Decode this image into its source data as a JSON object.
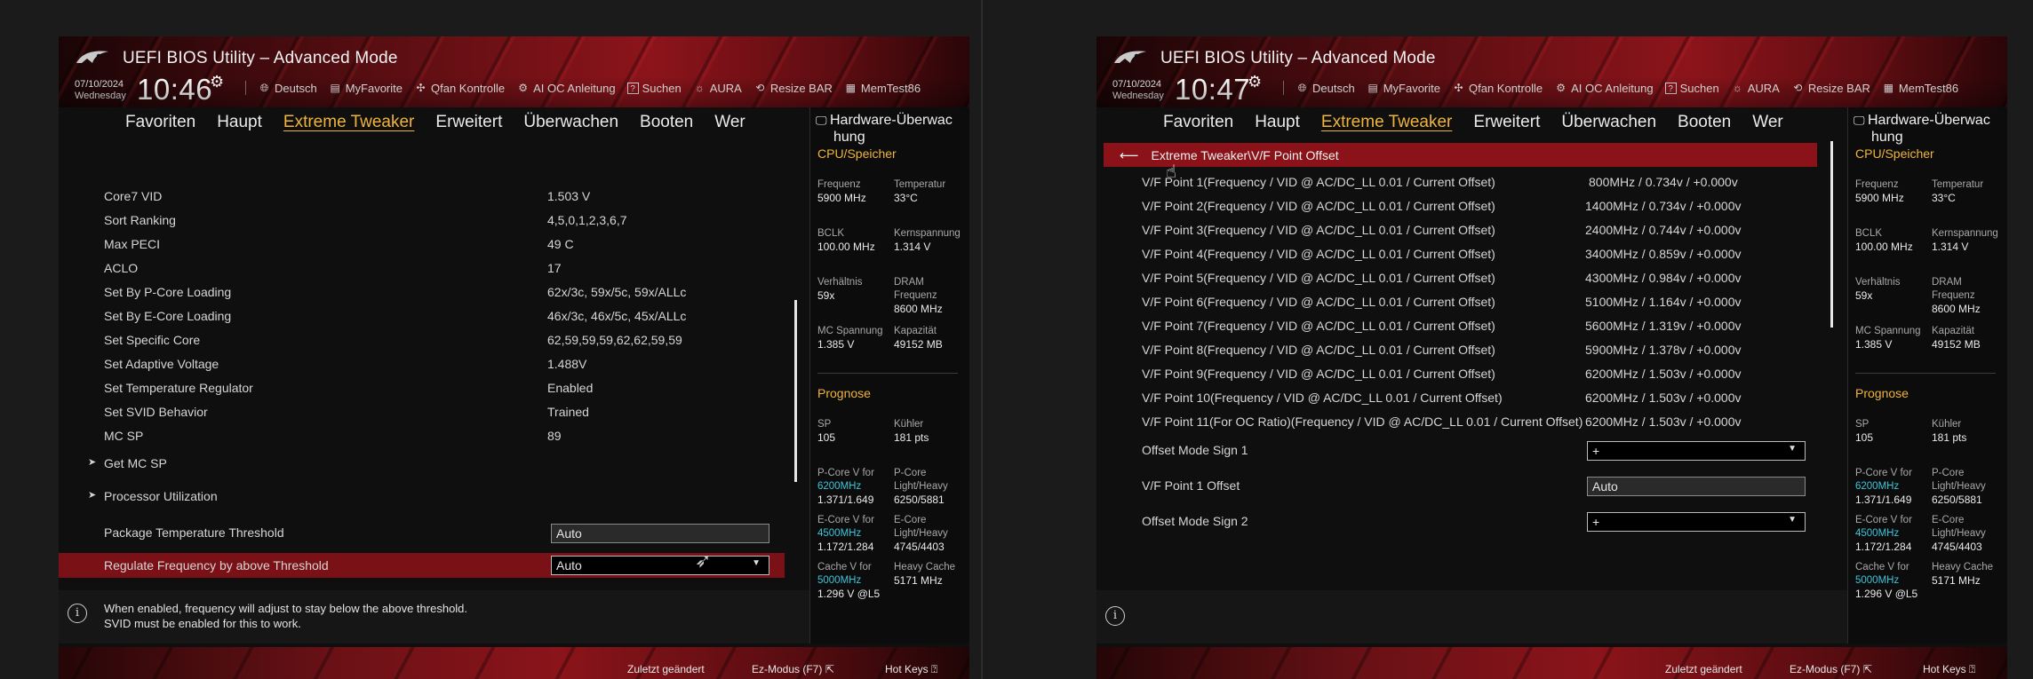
{
  "app": {
    "title": "UEFI BIOS Utility – Advanced Mode",
    "date": "07/10/2024",
    "weekday": "Wednesday"
  },
  "toolbar": {
    "language": "Deutsch",
    "myfavorite": "MyFavorite",
    "qfan": "Qfan Kontrolle",
    "aioc": "AI OC Anleitung",
    "search": "Suchen",
    "aura": "AURA",
    "resizebar": "Resize BAR",
    "memtest": "MemTest86",
    "search_key": "?"
  },
  "menu": [
    "Favoriten",
    "Haupt",
    "Extreme Tweaker",
    "Erweitert",
    "Überwachen",
    "Booten",
    "Wer"
  ],
  "left": {
    "clock": "10:46",
    "rows": [
      {
        "label": "Core7 VID",
        "value": "1.503 V"
      },
      {
        "label": "Sort Ranking",
        "value": "4,5,0,1,2,3,6,7"
      },
      {
        "label": "Max PECI",
        "value": "49 C"
      },
      {
        "label": "ACLO",
        "value": "17"
      },
      {
        "label": "Set By P-Core Loading",
        "value": "62x/3c, 59x/5c, 59x/ALLc"
      },
      {
        "label": "Set By E-Core Loading",
        "value": "46x/3c, 46x/5c, 45x/ALLc"
      },
      {
        "label": "Set Specific Core",
        "value": "62,59,59,59,62,62,59,59"
      },
      {
        "label": "Set Adaptive Voltage",
        "value": "1.488V"
      },
      {
        "label": "Set Temperature Regulator",
        "value": "Enabled"
      },
      {
        "label": "Set SVID Behavior",
        "value": "Trained"
      },
      {
        "label": "MC SP",
        "value": "89"
      }
    ],
    "submenus": [
      "Get MC SP",
      "Processor Utilization"
    ],
    "threshold_label": "Package Temperature Threshold",
    "threshold_value": "Auto",
    "regulate_label": "Regulate Frequency by above Threshold",
    "regulate_value": "Auto",
    "info_line1": "When enabled, frequency will adjust to stay below the above threshold.",
    "info_line2": "SVID must be enabled for this to work."
  },
  "right": {
    "clock": "10:47",
    "breadcrumb": "Extreme Tweaker\\V/F Point Offset",
    "points": [
      {
        "label": "V/F Point 1(Frequency / VID @ AC/DC_LL 0.01 / Current Offset)",
        "value": "800MHz / 0.734v / +0.000v"
      },
      {
        "label": "V/F Point 2(Frequency / VID @ AC/DC_LL 0.01 / Current Offset)",
        "value": "1400MHz / 0.734v / +0.000v"
      },
      {
        "label": "V/F Point 3(Frequency / VID @ AC/DC_LL 0.01 / Current Offset)",
        "value": "2400MHz / 0.744v / +0.000v"
      },
      {
        "label": "V/F Point 4(Frequency / VID @ AC/DC_LL 0.01 / Current Offset)",
        "value": "3400MHz / 0.859v / +0.000v"
      },
      {
        "label": "V/F Point 5(Frequency / VID @ AC/DC_LL 0.01 / Current Offset)",
        "value": "4300MHz / 0.984v / +0.000v"
      },
      {
        "label": "V/F Point 6(Frequency / VID @ AC/DC_LL 0.01 / Current Offset)",
        "value": "5100MHz / 1.164v / +0.000v"
      },
      {
        "label": "V/F Point 7(Frequency / VID @ AC/DC_LL 0.01 / Current Offset)",
        "value": "5600MHz / 1.319v / +0.000v"
      },
      {
        "label": "V/F Point 8(Frequency / VID @ AC/DC_LL 0.01 / Current Offset)",
        "value": "5900MHz / 1.378v / +0.000v"
      },
      {
        "label": "V/F Point 9(Frequency / VID @ AC/DC_LL 0.01 / Current Offset)",
        "value": "6200MHz / 1.503v / +0.000v"
      },
      {
        "label": "V/F Point 10(Frequency / VID @ AC/DC_LL 0.01 / Current Offset)",
        "value": "6200MHz / 1.503v / +0.000v"
      },
      {
        "label": "V/F Point 11(For OC Ratio)(Frequency / VID @ AC/DC_LL 0.01 / Current Offset)",
        "value": "6200MHz / 1.503v / +0.000v"
      }
    ],
    "sign1_label": "Offset Mode Sign 1",
    "sign1_value": "+",
    "offset1_label": "V/F Point 1 Offset",
    "offset1_value": "Auto",
    "sign2_label": "Offset Mode Sign 2",
    "sign2_value": "+"
  },
  "hw": {
    "title": "Hardware-Überwachung",
    "title_line1": "Hardware-Überwac",
    "title_line2": "hung",
    "cpu_section": "CPU/Speicher",
    "freq_k": "Frequenz",
    "freq_v": "5900 MHz",
    "temp_k": "Temperatur",
    "temp_v": "33°C",
    "bclk_k": "BCLK",
    "bclk_v": "100.00 MHz",
    "core_k": "Kernspannung",
    "core_v": "1.314 V",
    "ratio_k": "Verhältnis",
    "ratio_v": "59x",
    "dram_k1": "DRAM",
    "dram_k2": "Frequenz",
    "dram_v": "8600 MHz",
    "mc_k": "MC Spannung",
    "mc_v": "1.385 V",
    "cap_k": "Kapazität",
    "cap_v": "49152 MB",
    "prog_section": "Prognose",
    "sp_k": "SP",
    "sp_v": "105",
    "cool_k": "Kühler",
    "cool_v": "181 pts",
    "pcore_k": "P-Core V for",
    "pcore_hl": "6200MHz",
    "pcore_v": "1.371/1.649",
    "pcorelh_k1": "P-Core",
    "pcorelh_k2": "Light/Heavy",
    "pcorelh_v": "6250/5881",
    "ecore_k": "E-Core V for",
    "ecore_hl": "4500MHz",
    "ecore_v": "1.172/1.284",
    "ecorelh_k1": "E-Core",
    "ecorelh_k2": "Light/Heavy",
    "ecorelh_v": "4745/4403",
    "cache_k": "Cache V for",
    "cache_hl": "5000MHz",
    "cache_v": "1.296 V @L5",
    "hcache_k": "Heavy Cache",
    "hcache_v": "5171 MHz"
  },
  "footer": {
    "last_changed": "Zuletzt geändert",
    "ez_mode": "Ez-Modus (F7)",
    "hotkeys": "Hot Keys"
  },
  "colors": {
    "accent": "#f0b43c",
    "highlight_row": "#7a1116",
    "cyan": "#3ec4dc",
    "header_red": "#8c141b"
  }
}
